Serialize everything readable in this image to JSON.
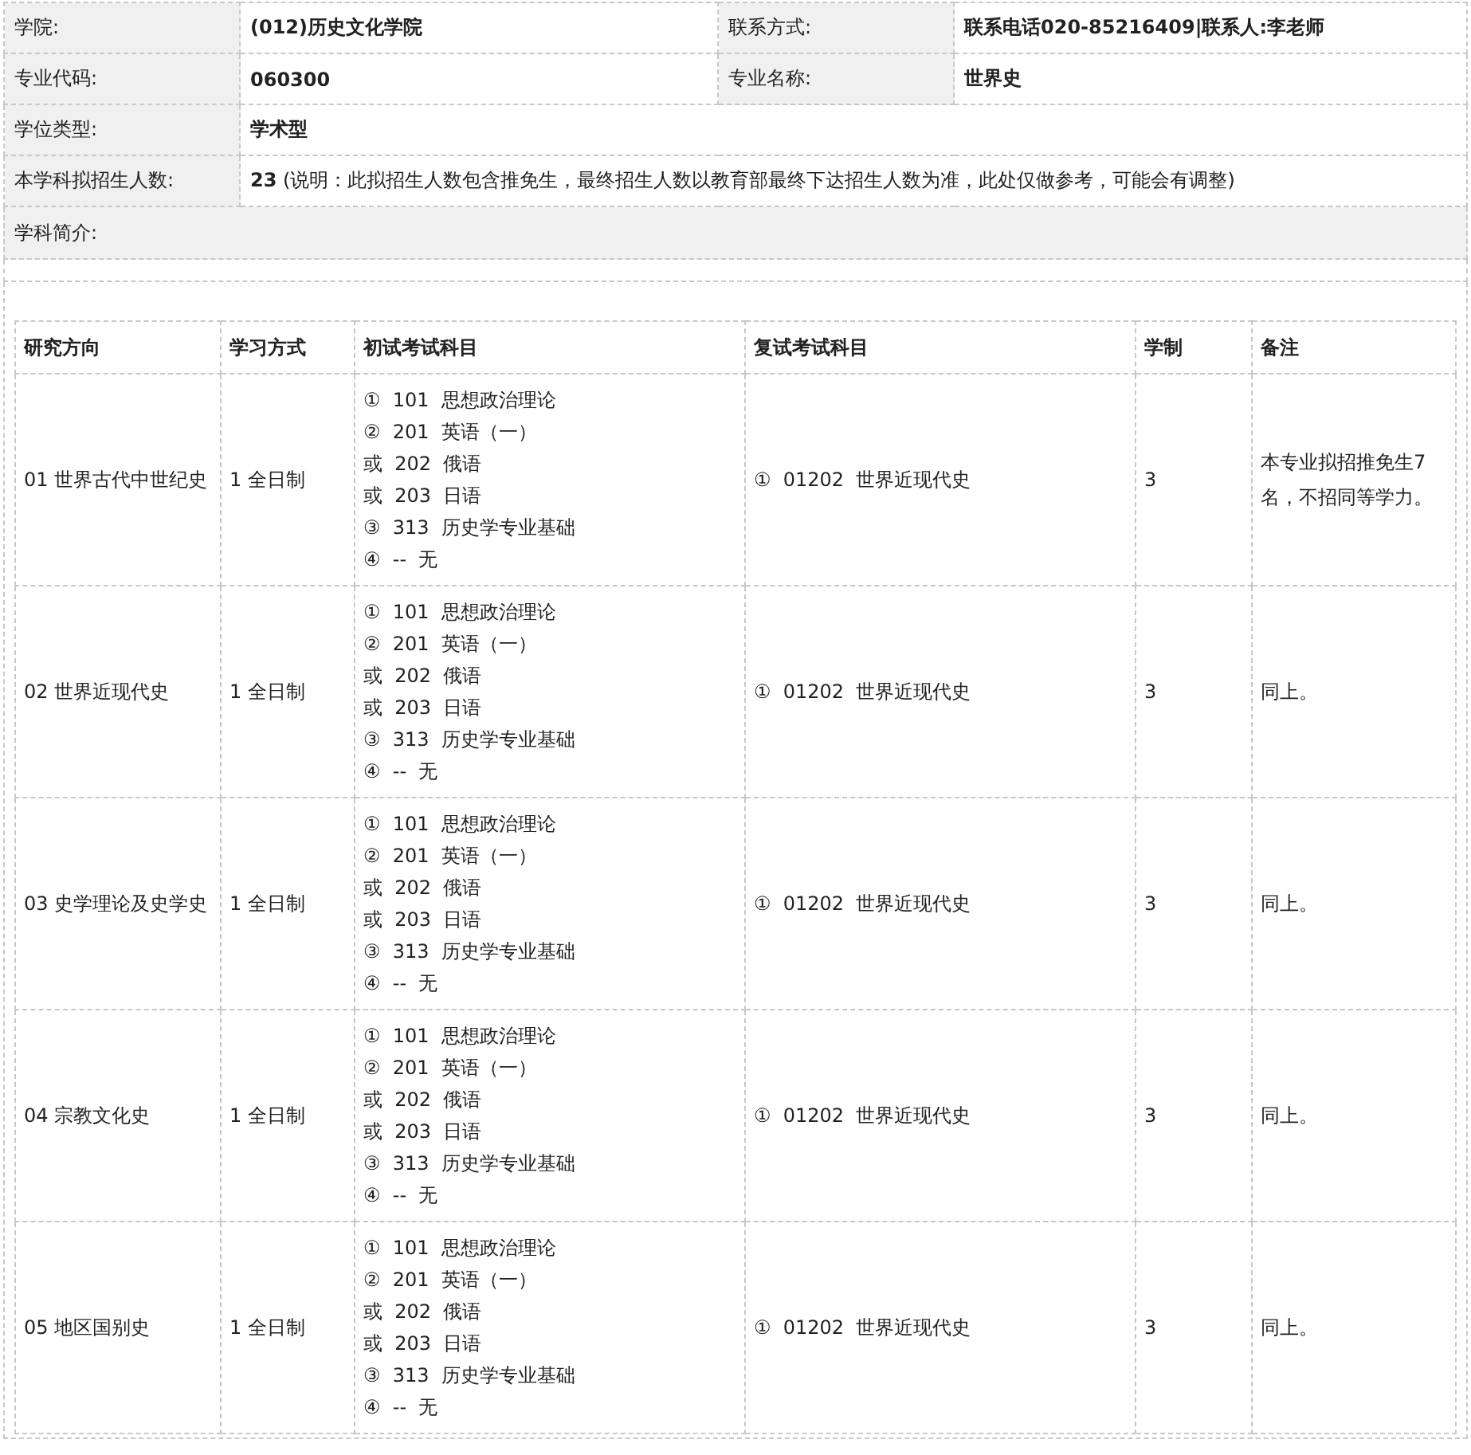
{
  "info": {
    "rows": [
      [
        {
          "label": "学院:",
          "value": "(012)历史文化学院"
        },
        {
          "label": "联系方式:",
          "value": "联系电话020-85216409|联系人:李老师"
        }
      ],
      [
        {
          "label": "专业代码:",
          "value": "060300"
        },
        {
          "label": "专业名称:",
          "value": "世界史"
        }
      ],
      [
        {
          "label": "学位类型:",
          "value": "学术型"
        }
      ],
      [
        {
          "label": "本学科拟招生人数:",
          "value": "**23** (说明：此拟招生人数包含推免生，最终招生人数以教育部最终下达招生人数为准，此处仅做参考，可能会有调整)"
        }
      ]
    ]
  },
  "intro": {
    "label": "学科简介:"
  },
  "table": {
    "columns": [
      "研究方向",
      "学习方式",
      "初试考试科目",
      "复试考试科目",
      "学制",
      "备注"
    ],
    "rows": [
      {
        "direction": "01 世界古代中世纪史",
        "mode": "1 全日制",
        "exam": [
          "①  101  思想政治理论",
          "②  201  英语（一）",
          "或  202  俄语",
          "或  203  日语",
          "③  313  历史学专业基础",
          "④  --  无"
        ],
        "retest": "①  01202  世界近现代史",
        "years": "3",
        "note": "本专业拟招推免生7名，不招同等学力。"
      },
      {
        "direction": "02 世界近现代史",
        "mode": "1 全日制",
        "exam": [
          "①  101  思想政治理论",
          "②  201  英语（一）",
          "或  202  俄语",
          "或  203  日语",
          "③  313  历史学专业基础",
          "④  --  无"
        ],
        "retest": "①  01202  世界近现代史",
        "years": "3",
        "note": "同上。"
      },
      {
        "direction": "03 史学理论及史学史",
        "mode": "1 全日制",
        "exam": [
          "①  101  思想政治理论",
          "②  201  英语（一）",
          "或  202  俄语",
          "或  203  日语",
          "③  313  历史学专业基础",
          "④  --  无"
        ],
        "retest": "①  01202  世界近现代史",
        "years": "3",
        "note": "同上。"
      },
      {
        "direction": "04 宗教文化史",
        "mode": "1 全日制",
        "exam": [
          "①  101  思想政治理论",
          "②  201  英语（一）",
          "或  202  俄语",
          "或  203  日语",
          "③  313  历史学专业基础",
          "④  --  无"
        ],
        "retest": "①  01202  世界近现代史",
        "years": "3",
        "note": "同上。"
      },
      {
        "direction": "05 地区国别史",
        "mode": "1 全日制",
        "exam": [
          "①  101  思想政治理论",
          "②  201  英语（一）",
          "或  202  俄语",
          "或  203  日语",
          "③  313  历史学专业基础",
          "④  --  无"
        ],
        "retest": "①  01202  世界近现代史",
        "years": "3",
        "note": "同上。"
      }
    ]
  }
}
